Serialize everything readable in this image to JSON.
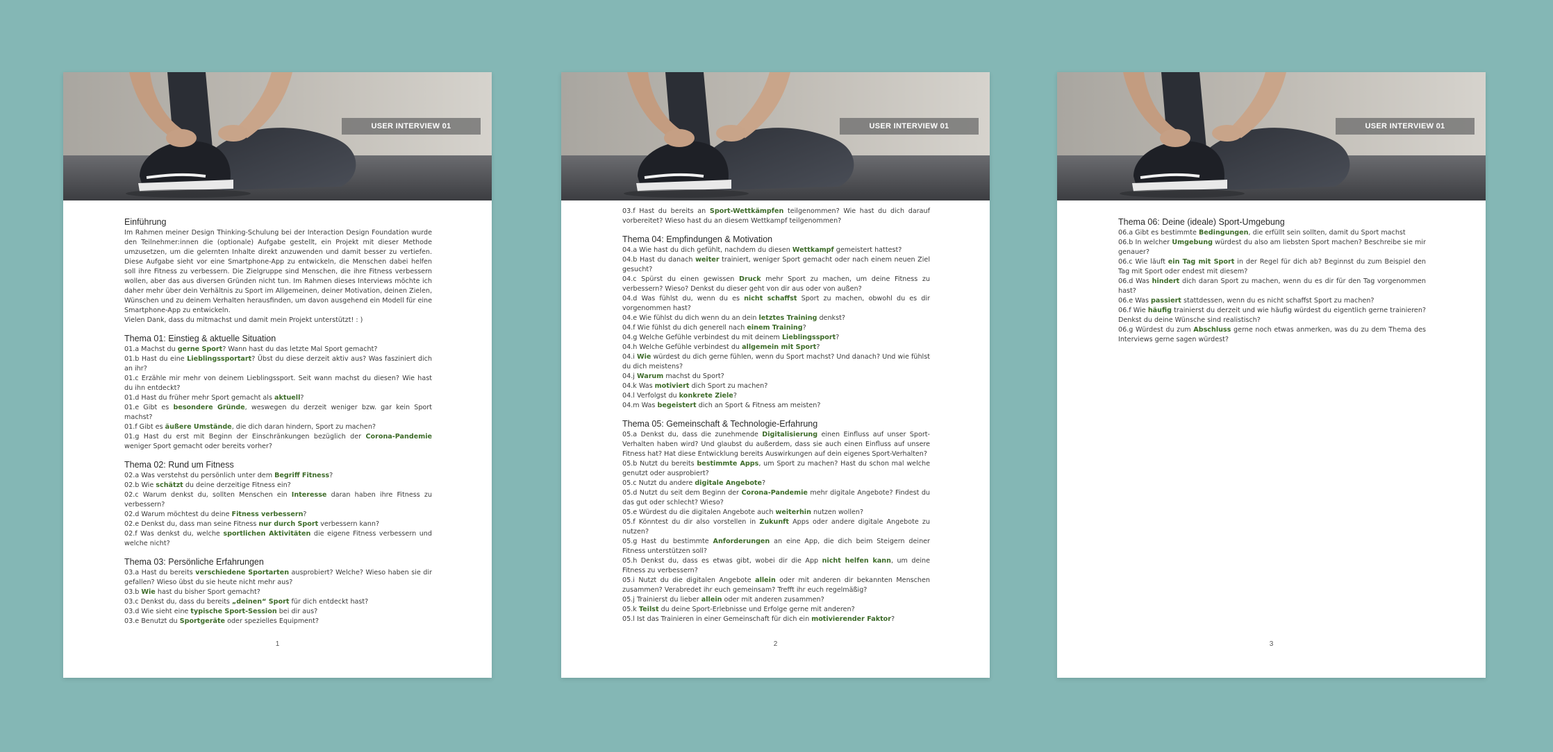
{
  "header_label": "USER INTERVIEW 01",
  "pages": [
    {
      "number": "1",
      "sections": [
        {
          "title": "Einführung",
          "paragraphs": [
            "Im Rahmen meiner Design Thinking-Schulung bei der Interaction Design Foundation wurde den Teilnehmer:innen die (optionale) Aufgabe gestellt, ein Projekt mit dieser Methode umzusetzen, um die gelernten Inhalte direkt anzuwenden und damit besser zu vertiefen. Diese Aufgabe sieht vor eine Smartphone-App zu entwickeln, die Menschen dabei helfen soll ihre Fitness zu verbessern. Die Zielgruppe sind Menschen, die ihre Fitness verbessern wollen, aber das aus diversen Gründen nicht tun. Im Rahmen dieses Interviews möchte ich daher mehr über dein Verhältnis zu Sport im Allgemeinen, deiner Motivation, deinen Zielen, Wünschen und zu deinem Verhalten herausfinden, um davon ausgehend ein Modell für eine Smartphone-App zu entwickeln.",
            "Vielen Dank, dass du mitmachst und damit mein Projekt unterstützt! : )"
          ]
        },
        {
          "title": "Thema 01: Einstieg & aktuelle Situation",
          "questions": [
            [
              [
                "01.a Machst du ",
                false
              ],
              [
                "gerne Sport",
                true
              ],
              [
                "? Wann hast du das letzte Mal Sport gemacht?",
                false
              ]
            ],
            [
              [
                "01.b Hast du eine ",
                false
              ],
              [
                "Lieblingssportart",
                true
              ],
              [
                "? Übst du diese derzeit aktiv aus? Was fasziniert dich an ihr?",
                false
              ]
            ],
            [
              [
                "01.c Erzähle mir mehr von deinem Lieblingssport. Seit wann machst du diesen? Wie hast du ihn entdeckt?",
                false
              ]
            ],
            [
              [
                "01.d Hast du früher mehr Sport gemacht als ",
                false
              ],
              [
                "aktuell",
                true
              ],
              [
                "?",
                false
              ]
            ],
            [
              [
                "01.e Gibt es ",
                false
              ],
              [
                "besondere Gründe",
                true
              ],
              [
                ", weswegen du derzeit weniger bzw. gar kein Sport machst?",
                false
              ]
            ],
            [
              [
                "01.f Gibt es ",
                false
              ],
              [
                "äußere Umstände",
                true
              ],
              [
                ", die dich daran hindern, Sport zu machen?",
                false
              ]
            ],
            [
              [
                "01.g Hast du erst mit Beginn der Einschränkungen bezüglich der ",
                false
              ],
              [
                "Corona-Pandemie",
                true
              ],
              [
                " weniger Sport gemacht oder bereits vorher?",
                false
              ]
            ]
          ]
        },
        {
          "title": "Thema 02: Rund um Fitness",
          "questions": [
            [
              [
                "02.a Was verstehst du persönlich unter dem ",
                false
              ],
              [
                "Begriff Fitness",
                true
              ],
              [
                "?",
                false
              ]
            ],
            [
              [
                "02.b Wie ",
                false
              ],
              [
                "schätzt",
                true
              ],
              [
                " du deine derzeitige Fitness ein?",
                false
              ]
            ],
            [
              [
                "02.c Warum denkst du, sollten Menschen ein ",
                false
              ],
              [
                "Interesse",
                true
              ],
              [
                " daran haben ihre Fitness zu verbessern?",
                false
              ]
            ],
            [
              [
                "02.d Warum möchtest du deine ",
                false
              ],
              [
                "Fitness verbessern",
                true
              ],
              [
                "?",
                false
              ]
            ],
            [
              [
                "02.e Denkst du, dass man seine Fitness ",
                false
              ],
              [
                "nur durch Sport",
                true
              ],
              [
                " verbessern kann?",
                false
              ]
            ],
            [
              [
                "02.f Was denkst du, welche ",
                false
              ],
              [
                "sportlichen Aktivitäten",
                true
              ],
              [
                " die eigene Fitness verbessern und welche nicht?",
                false
              ]
            ]
          ]
        },
        {
          "title": "Thema 03: Persönliche Erfahrungen",
          "questions": [
            [
              [
                "03.a Hast du bereits ",
                false
              ],
              [
                "verschiedene Sportarten",
                true
              ],
              [
                " ausprobiert? Welche? Wieso haben sie dir gefallen? Wieso übst du sie heute nicht mehr aus?",
                false
              ]
            ],
            [
              [
                "03.b ",
                false
              ],
              [
                "Wie",
                true
              ],
              [
                " hast du bisher Sport gemacht?",
                false
              ]
            ],
            [
              [
                "03.c Denkst du, dass du bereits ",
                false
              ],
              [
                "„deinen“ Sport",
                true
              ],
              [
                " für dich entdeckt hast?",
                false
              ]
            ],
            [
              [
                "03.d Wie sieht eine ",
                false
              ],
              [
                "typische Sport-Session",
                true
              ],
              [
                " bei dir aus?",
                false
              ]
            ],
            [
              [
                "03.e Benutzt du ",
                false
              ],
              [
                "Sportgeräte",
                true
              ],
              [
                " oder spezielles Equipment?",
                false
              ]
            ]
          ]
        }
      ]
    },
    {
      "number": "2",
      "sections": [
        {
          "title": "",
          "questions": [
            [
              [
                "03.f Hast du bereits an ",
                false
              ],
              [
                "Sport-Wettkämpfen",
                true
              ],
              [
                " teilgenommen? Wie hast du dich darauf vorbereitet? Wieso hast du an diesem Wettkampf teilgenommen?",
                false
              ]
            ]
          ]
        },
        {
          "title": "Thema 04: Empfindungen & Motivation",
          "questions": [
            [
              [
                "04.a Wie hast du dich gefühlt, nachdem du diesen ",
                false
              ],
              [
                "Wettkampf",
                true
              ],
              [
                " gemeistert hattest?",
                false
              ]
            ],
            [
              [
                "04.b Hast du danach ",
                false
              ],
              [
                "weiter",
                true
              ],
              [
                " trainiert, weniger Sport gemacht oder nach einem neuen Ziel gesucht?",
                false
              ]
            ],
            [
              [
                "04.c Spürst du einen gewissen ",
                false
              ],
              [
                "Druck",
                true
              ],
              [
                " mehr Sport zu machen, um deine Fitness zu verbessern? Wieso? Denkst du dieser geht von dir aus oder von außen?",
                false
              ]
            ],
            [
              [
                "04.d Was fühlst du, wenn du es ",
                false
              ],
              [
                "nicht schaffst",
                true
              ],
              [
                " Sport zu machen, obwohl du es dir vorgenommen hast?",
                false
              ]
            ],
            [
              [
                "04.e Wie fühlst du dich wenn du an dein ",
                false
              ],
              [
                "letztes Training",
                true
              ],
              [
                " denkst?",
                false
              ]
            ],
            [
              [
                "04.f Wie fühlst du dich generell nach ",
                false
              ],
              [
                "einem Training",
                true
              ],
              [
                "?",
                false
              ]
            ],
            [
              [
                "04.g Welche Gefühle verbindest du mit deinem ",
                false
              ],
              [
                "Lieblingssport",
                true
              ],
              [
                "?",
                false
              ]
            ],
            [
              [
                "04.h Welche Gefühle verbindest du ",
                false
              ],
              [
                "allgemein mit Sport",
                true
              ],
              [
                "?",
                false
              ]
            ],
            [
              [
                "04.i ",
                false
              ],
              [
                "Wie",
                true
              ],
              [
                " würdest du dich gerne fühlen, wenn du Sport machst? Und danach? Und wie fühlst du dich meistens?",
                false
              ]
            ],
            [
              [
                "04.j ",
                false
              ],
              [
                "Warum",
                true
              ],
              [
                " machst du Sport?",
                false
              ]
            ],
            [
              [
                "04.k Was ",
                false
              ],
              [
                "motiviert",
                true
              ],
              [
                " dich Sport zu machen?",
                false
              ]
            ],
            [
              [
                "04.l Verfolgst du ",
                false
              ],
              [
                "konkrete Ziele",
                true
              ],
              [
                "?",
                false
              ]
            ],
            [
              [
                "04.m Was ",
                false
              ],
              [
                "begeistert",
                true
              ],
              [
                " dich an Sport & Fitness am meisten?",
                false
              ]
            ]
          ]
        },
        {
          "title": "Thema 05: Gemeinschaft & Technologie-Erfahrung",
          "questions": [
            [
              [
                "05.a Denkst du, dass die zunehmende ",
                false
              ],
              [
                "Digitalisierung",
                true
              ],
              [
                " einen Einfluss auf unser Sport-Verhalten haben wird? Und glaubst du außerdem, dass sie auch einen Einfluss auf unsere Fitness hat? Hat diese Entwicklung bereits Auswirkungen auf dein eigenes Sport-Verhalten?",
                false
              ]
            ],
            [
              [
                "05.b Nutzt du bereits ",
                false
              ],
              [
                "bestimmte Apps",
                true
              ],
              [
                ", um Sport zu machen? Hast du schon mal welche genutzt oder ausprobiert?",
                false
              ]
            ],
            [
              [
                "05.c Nutzt du andere ",
                false
              ],
              [
                "digitale Angebote",
                true
              ],
              [
                "?",
                false
              ]
            ],
            [
              [
                "05.d Nutzt du seit dem Beginn der ",
                false
              ],
              [
                "Corona-Pandemie",
                true
              ],
              [
                " mehr digitale Angebote? Findest du das gut oder schlecht? Wieso?",
                false
              ]
            ],
            [
              [
                "05.e Würdest du die digitalen Angebote auch ",
                false
              ],
              [
                "weiterhin",
                true
              ],
              [
                " nutzen wollen?",
                false
              ]
            ],
            [
              [
                "05.f Könntest du dir also vorstellen in ",
                false
              ],
              [
                "Zukunft",
                true
              ],
              [
                " Apps oder andere digitale Angebote zu nutzen?",
                false
              ]
            ],
            [
              [
                "05.g Hast du bestimmte ",
                false
              ],
              [
                "Anforderungen",
                true
              ],
              [
                " an eine App, die dich beim Steigern deiner Fitness unterstützen soll?",
                false
              ]
            ],
            [
              [
                "05.h Denkst du, dass es etwas gibt, wobei dir die App ",
                false
              ],
              [
                "nicht helfen kann",
                true
              ],
              [
                ", um deine Fitness zu verbessern?",
                false
              ]
            ],
            [
              [
                "05.i Nutzt du die digitalen Angebote ",
                false
              ],
              [
                "allein",
                true
              ],
              [
                " oder mit anderen dir bekannten Menschen zusammen? Verabredet ihr euch gemeinsam? Trefft ihr euch regelmäßig?",
                false
              ]
            ],
            [
              [
                "05.j Trainierst du lieber ",
                false
              ],
              [
                "allein",
                true
              ],
              [
                " oder mit anderen zusammen?",
                false
              ]
            ],
            [
              [
                "05.k ",
                false
              ],
              [
                "Teilst",
                true
              ],
              [
                " du deine Sport-Erlebnisse und Erfolge gerne mit anderen?",
                false
              ]
            ],
            [
              [
                "05.l Ist das Trainieren in einer Gemeinschaft für dich ein ",
                false
              ],
              [
                "motivierender Faktor",
                true
              ],
              [
                "?",
                false
              ]
            ]
          ]
        }
      ]
    },
    {
      "number": "3",
      "sections": [
        {
          "title": "Thema 06: Deine (ideale) Sport-Umgebung",
          "questions": [
            [
              [
                "06.a Gibt es bestimmte ",
                false
              ],
              [
                "Bedingungen",
                true
              ],
              [
                ", die erfüllt sein sollten, damit du Sport machst",
                false
              ]
            ],
            [
              [
                "06.b In welcher ",
                false
              ],
              [
                "Umgebung",
                true
              ],
              [
                " würdest du also am liebsten Sport machen? Beschreibe sie mir genauer?",
                false
              ]
            ],
            [
              [
                "06.c Wie läuft ",
                false
              ],
              [
                "ein Tag mit Sport",
                true
              ],
              [
                " in der Regel für dich ab? Beginnst du zum Beispiel den Tag mit Sport oder endest mit diesem?",
                false
              ]
            ],
            [
              [
                "06.d Was ",
                false
              ],
              [
                "hindert",
                true
              ],
              [
                " dich daran Sport zu machen, wenn du es dir für den Tag vorgenommen hast?",
                false
              ]
            ],
            [
              [
                "06.e Was ",
                false
              ],
              [
                "passiert",
                true
              ],
              [
                " stattdessen, wenn du es nicht schaffst Sport zu machen?",
                false
              ]
            ],
            [
              [
                "06.f Wie ",
                false
              ],
              [
                "häufig",
                true
              ],
              [
                " trainierst du derzeit und wie häufig würdest du eigentlich gerne trainieren? Denkst du deine Wünsche sind realistisch?",
                false
              ]
            ],
            [
              [
                "06.g Würdest du zum ",
                false
              ],
              [
                "Abschluss",
                true
              ],
              [
                " gerne noch etwas anmerken, was du zu dem Thema des Interviews gerne sagen würdest?",
                false
              ]
            ]
          ]
        }
      ]
    }
  ],
  "colors": {
    "background": "#84b7b5",
    "page": "#ffffff",
    "highlight": "#3e6b2a",
    "text": "#3a3a3a"
  }
}
